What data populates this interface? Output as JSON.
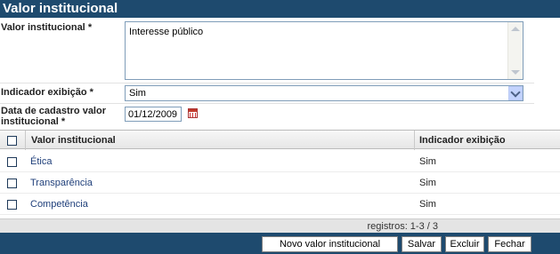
{
  "header": {
    "title": "Valor institucional"
  },
  "form": {
    "valor_label": "Valor institucional",
    "required_mark": "*",
    "valor_value": "Interesse público",
    "indicador_label": "Indicador exibição",
    "indicador_value": "Sim",
    "data_label_line1": "Data de cadastro valor",
    "data_label_line2": "institucional",
    "data_value": "01/12/2009"
  },
  "table": {
    "columns": [
      "Valor institucional",
      "Indicador exibição"
    ],
    "rows": [
      {
        "valor": "Ética",
        "indicador": "Sim"
      },
      {
        "valor": "Transparência",
        "indicador": "Sim"
      },
      {
        "valor": "Competência",
        "indicador": "Sim"
      }
    ]
  },
  "footer": {
    "registros": "registros: 1-3 / 3"
  },
  "buttons": {
    "novo": "Novo valor institucional",
    "salvar": "Salvar",
    "excluir": "Excluir",
    "fechar": "Fechar"
  },
  "colors": {
    "header_bg": "#1e4a6e",
    "link": "#1f3f7a"
  },
  "icons": [
    "calendar-icon",
    "dropdown-arrow-icon",
    "scroll-up-icon",
    "scroll-down-icon"
  ]
}
